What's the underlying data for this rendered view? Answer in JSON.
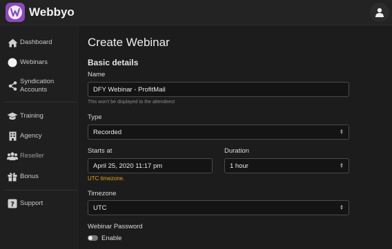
{
  "app": {
    "brand": "Webbyo"
  },
  "sidebar": {
    "items": [
      {
        "label": "Dashboard",
        "icon": "home-icon"
      },
      {
        "label": "Webinars",
        "icon": "circle-icon"
      },
      {
        "label": "Syndication Accounts",
        "icon": "share-icon"
      },
      {
        "label": "Training",
        "icon": "graduation-cap-icon"
      },
      {
        "label": "Agency",
        "icon": "building-icon"
      },
      {
        "label": "Reseller",
        "icon": "users-icon"
      },
      {
        "label": "Bonus",
        "icon": "gift-icon"
      },
      {
        "label": "Support",
        "icon": "question-icon"
      }
    ]
  },
  "form": {
    "page_title": "Create Webinar",
    "section_title": "Basic details",
    "name_label": "Name",
    "name_value": "DFY Webinar - ProfitMail",
    "name_hint": "This won't be displayed to the attendees!",
    "type_label": "Type",
    "type_value": "Recorded",
    "starts_label": "Starts at",
    "starts_value": "April 25, 2020 11:17 pm",
    "utc_note": "UTC timezone.",
    "duration_label": "Duration",
    "duration_value": "1 hour",
    "timezone_label": "Timezone",
    "timezone_value": "UTC",
    "password_label": "Webinar Password",
    "enable_label": "Enable"
  },
  "colors": {
    "accent": "#8a4bb8",
    "warning": "#e3a41a",
    "background": "#1c1c1c"
  }
}
